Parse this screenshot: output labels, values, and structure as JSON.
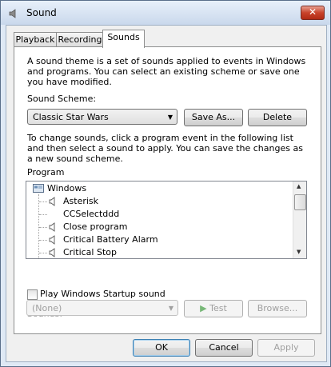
{
  "window": {
    "title": "Sound",
    "close_glyph": "✕"
  },
  "tabs": [
    {
      "label": "Playback"
    },
    {
      "label": "Recording"
    },
    {
      "label": "Sounds"
    }
  ],
  "intro_text": "A sound theme is a set of sounds applied to events in Windows and programs.  You can select an existing scheme or save one you have modified.",
  "scheme": {
    "label": "Sound Scheme:",
    "value": "Classic Star Wars",
    "save_as_label": "Save As...",
    "delete_label": "Delete"
  },
  "instructions_text": "To change sounds, click a program event in the following list and then select a sound to apply.  You can save the changes as a new sound scheme.",
  "program": {
    "label": "Program",
    "root": "Windows",
    "items": [
      {
        "label": "Asterisk",
        "has_sound": true
      },
      {
        "label": "CCSelectddd",
        "has_sound": false
      },
      {
        "label": "Close program",
        "has_sound": true
      },
      {
        "label": "Critical Battery Alarm",
        "has_sound": true
      },
      {
        "label": "Critical Stop",
        "has_sound": true
      }
    ]
  },
  "startup": {
    "label": "Play Windows Startup sound",
    "checked": false
  },
  "sounds": {
    "label": "Sounds:",
    "value": "(None)",
    "test_label": "Test",
    "browse_label": "Browse..."
  },
  "footer": {
    "ok_label": "OK",
    "cancel_label": "Cancel",
    "apply_label": "Apply"
  },
  "colors": {
    "accent": "#3c7fb1",
    "close_red": "#c8422a",
    "disabled_text": "#a0a0a0"
  }
}
